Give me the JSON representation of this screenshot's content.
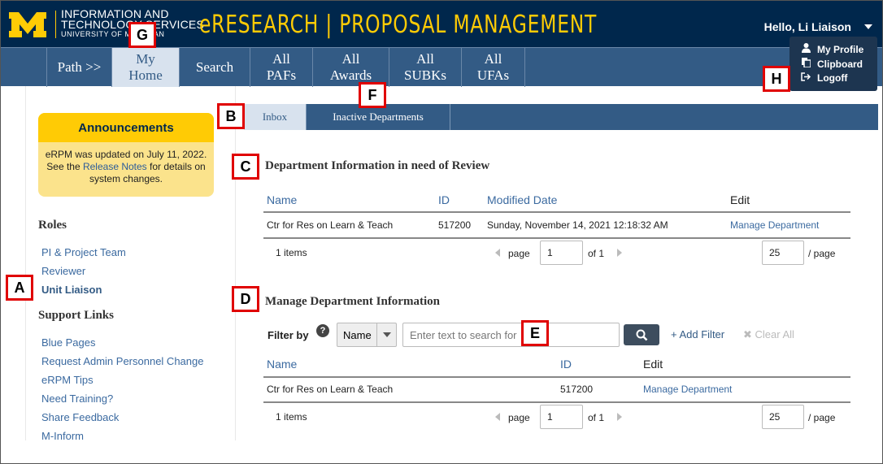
{
  "header": {
    "its_line1": "INFORMATION AND",
    "its_line2": "TECHNOLOGY SERVICES",
    "its_line3": "UNIVERSITY OF MICHIGAN",
    "app_title": "eRESEARCH  |  PROPOSAL MANAGEMENT",
    "greeting": "Hello, Li Liaison",
    "brand_color": "#00274c",
    "maize_color": "#ffcb05"
  },
  "user_menu": {
    "items": [
      {
        "label": "My Profile",
        "icon": "user-icon"
      },
      {
        "label": "Clipboard",
        "icon": "clipboard-icon"
      },
      {
        "label": "Logoff",
        "icon": "logoff-icon"
      }
    ]
  },
  "nav": {
    "items": [
      {
        "label": "Path >>"
      },
      {
        "label": "My Home",
        "active": true
      },
      {
        "label": "Search"
      },
      {
        "label": "All PAFs"
      },
      {
        "label": "All Awards"
      },
      {
        "label": "All SUBKs"
      },
      {
        "label": "All UFAs"
      }
    ]
  },
  "announcements": {
    "title": "Announcements",
    "text_before": "eRPM was updated on July 11, 2022. See the ",
    "link": "Release Notes",
    "text_after": " for details on system changes."
  },
  "sidebar": {
    "roles_heading": "Roles",
    "roles": [
      "PI & Project Team",
      "Reviewer",
      "Unit Liaison"
    ],
    "current_role": "Unit Liaison",
    "support_heading": "Support Links",
    "support_links": [
      "Blue Pages",
      "Request Admin Personnel Change",
      "eRPM Tips",
      "Need Training?",
      "Share Feedback",
      "M-Inform"
    ]
  },
  "tabs": [
    {
      "label": "Inbox",
      "active": true
    },
    {
      "label": "Inactive Departments",
      "active": false
    }
  ],
  "review_section": {
    "title": "Department Information in need of Review",
    "columns": [
      "Name",
      "ID",
      "Modified Date",
      "Edit"
    ],
    "rows": [
      {
        "name": "Ctr for Res on Learn & Teach",
        "id": "517200",
        "modified": "Sunday, November 14, 2021 12:18:32 AM",
        "edit": "Manage Department"
      }
    ],
    "pager": {
      "items": "1 items",
      "page_label": "page",
      "page": "1",
      "of": "of 1",
      "per_page": "25",
      "per_page_label": "/ page"
    }
  },
  "manage_section": {
    "title": "Manage Department Information",
    "filter_label": "Filter by",
    "filter_field": "Name",
    "search_placeholder": "Enter text to search for",
    "add_filter": "+ Add Filter",
    "clear_all": "✖ Clear All",
    "columns": [
      "Name",
      "ID",
      "Edit"
    ],
    "rows": [
      {
        "name": "Ctr for Res on Learn & Teach",
        "id": "517200",
        "edit": "Manage Department"
      }
    ],
    "pager": {
      "items": "1 items",
      "page_label": "page",
      "page": "1",
      "of": "of 1",
      "per_page": "25",
      "per_page_label": "/ page"
    }
  },
  "callouts": [
    "A",
    "B",
    "C",
    "D",
    "E",
    "F",
    "G",
    "H"
  ]
}
